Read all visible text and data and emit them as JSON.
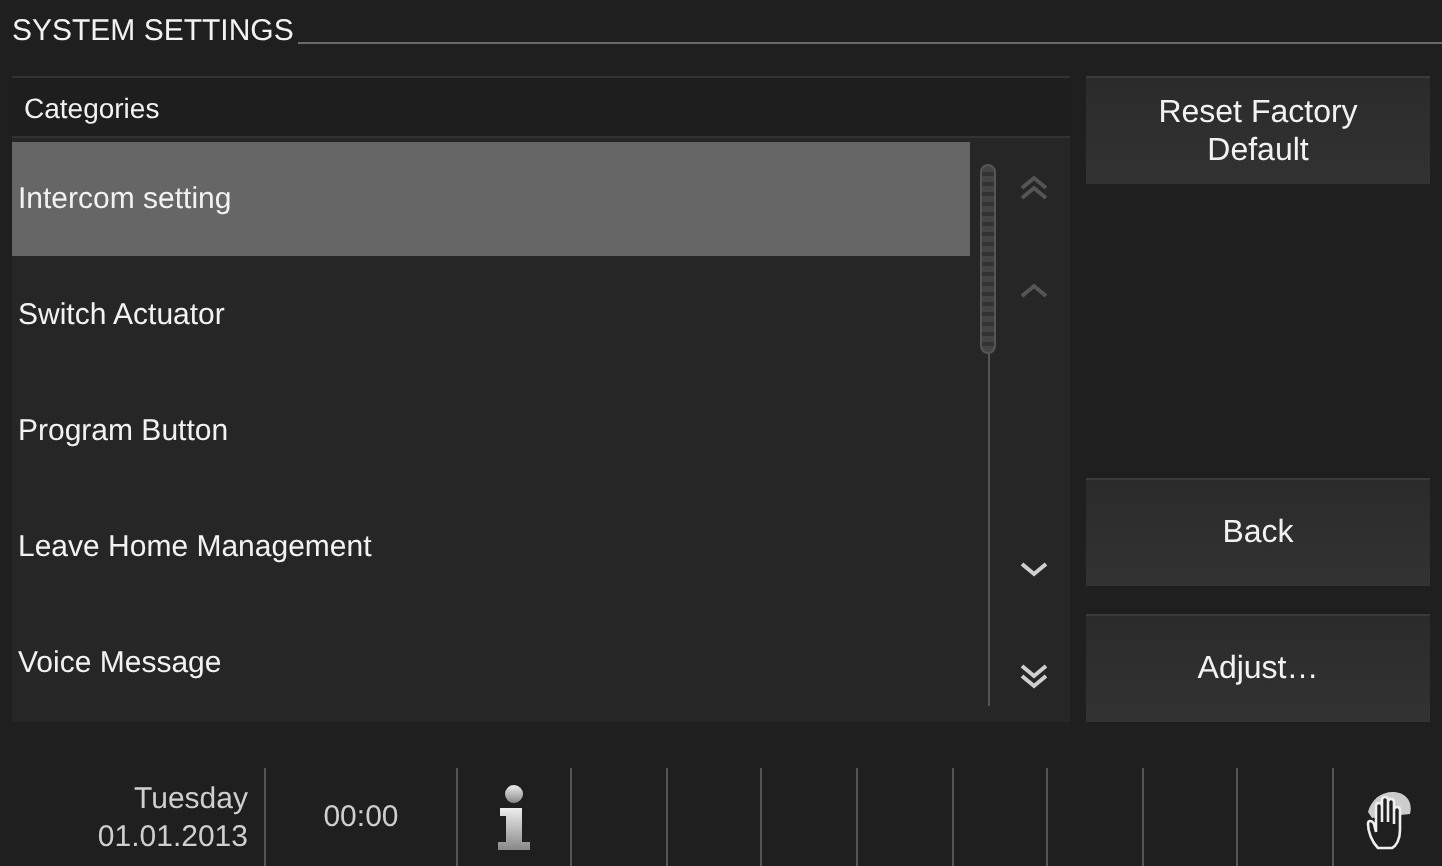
{
  "title": "SYSTEM SETTINGS",
  "categories": {
    "header": "Categories",
    "items": [
      {
        "label": "Intercom setting",
        "selected": true
      },
      {
        "label": "Switch Actuator",
        "selected": false
      },
      {
        "label": "Program Button",
        "selected": false
      },
      {
        "label": "Leave Home Management",
        "selected": false
      },
      {
        "label": "Voice Message",
        "selected": false
      }
    ],
    "scroll_buttons": [
      {
        "kind": "page-up",
        "disabled": true
      },
      {
        "kind": "up",
        "disabled": true
      },
      {
        "kind": "down",
        "disabled": false
      },
      {
        "kind": "page-down",
        "disabled": false
      }
    ]
  },
  "actions": [
    {
      "label": "Reset Factory Default",
      "kind": "top"
    },
    {
      "label": "Back",
      "kind": "bottom"
    },
    {
      "label": "Adjust…",
      "kind": "bottom"
    }
  ],
  "status_bar": {
    "day": "Tuesday",
    "date": "01.01.2013",
    "time": "00:00"
  }
}
